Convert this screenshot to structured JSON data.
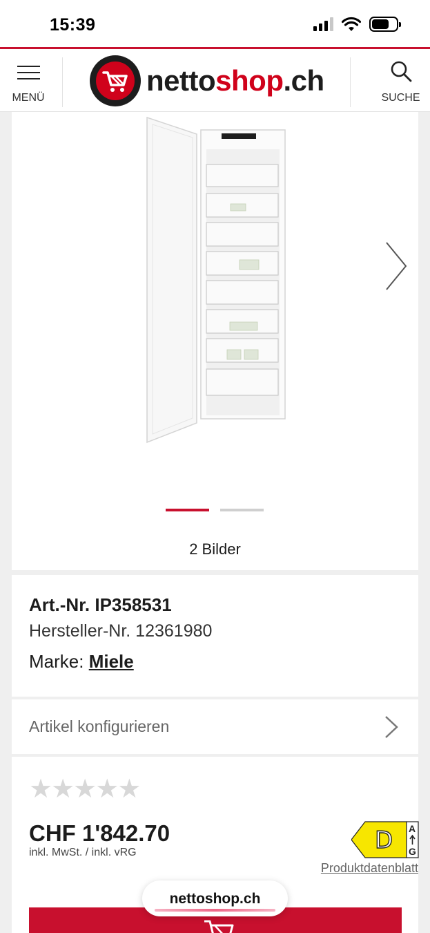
{
  "status_bar": {
    "time": "15:39",
    "icons": [
      "cellular-signal-icon",
      "wifi-icon",
      "battery-icon"
    ]
  },
  "header": {
    "menu_label": "MENÜ",
    "logo_text_1": "netto",
    "logo_text_2": "shop",
    "logo_text_3": ".ch",
    "search_label": "SUCHE"
  },
  "gallery": {
    "image_count_label": "2 Bilder",
    "active_index": 0,
    "total_images": 2
  },
  "product_info": {
    "art_nr": "Art.-Nr. IP358531",
    "hersteller_nr": "Hersteller-Nr. 12361980",
    "brand_label": "Marke:",
    "brand": "Miele"
  },
  "configure": {
    "label": "Artikel konfigurieren"
  },
  "pricing": {
    "rating": 0,
    "rating_max": 5,
    "price": "CHF 1'842.70",
    "price_note": "inkl. MwSt. / inkl. vRG",
    "energy_class": "D",
    "energy_scale_top": "A",
    "energy_scale_bottom": "G",
    "datasheet_link": "Produktdatenblatt"
  },
  "browser": {
    "url": "nettoshop.ch"
  },
  "colors": {
    "brand_red": "#c8102e",
    "energy_yellow": "#f7e600"
  }
}
